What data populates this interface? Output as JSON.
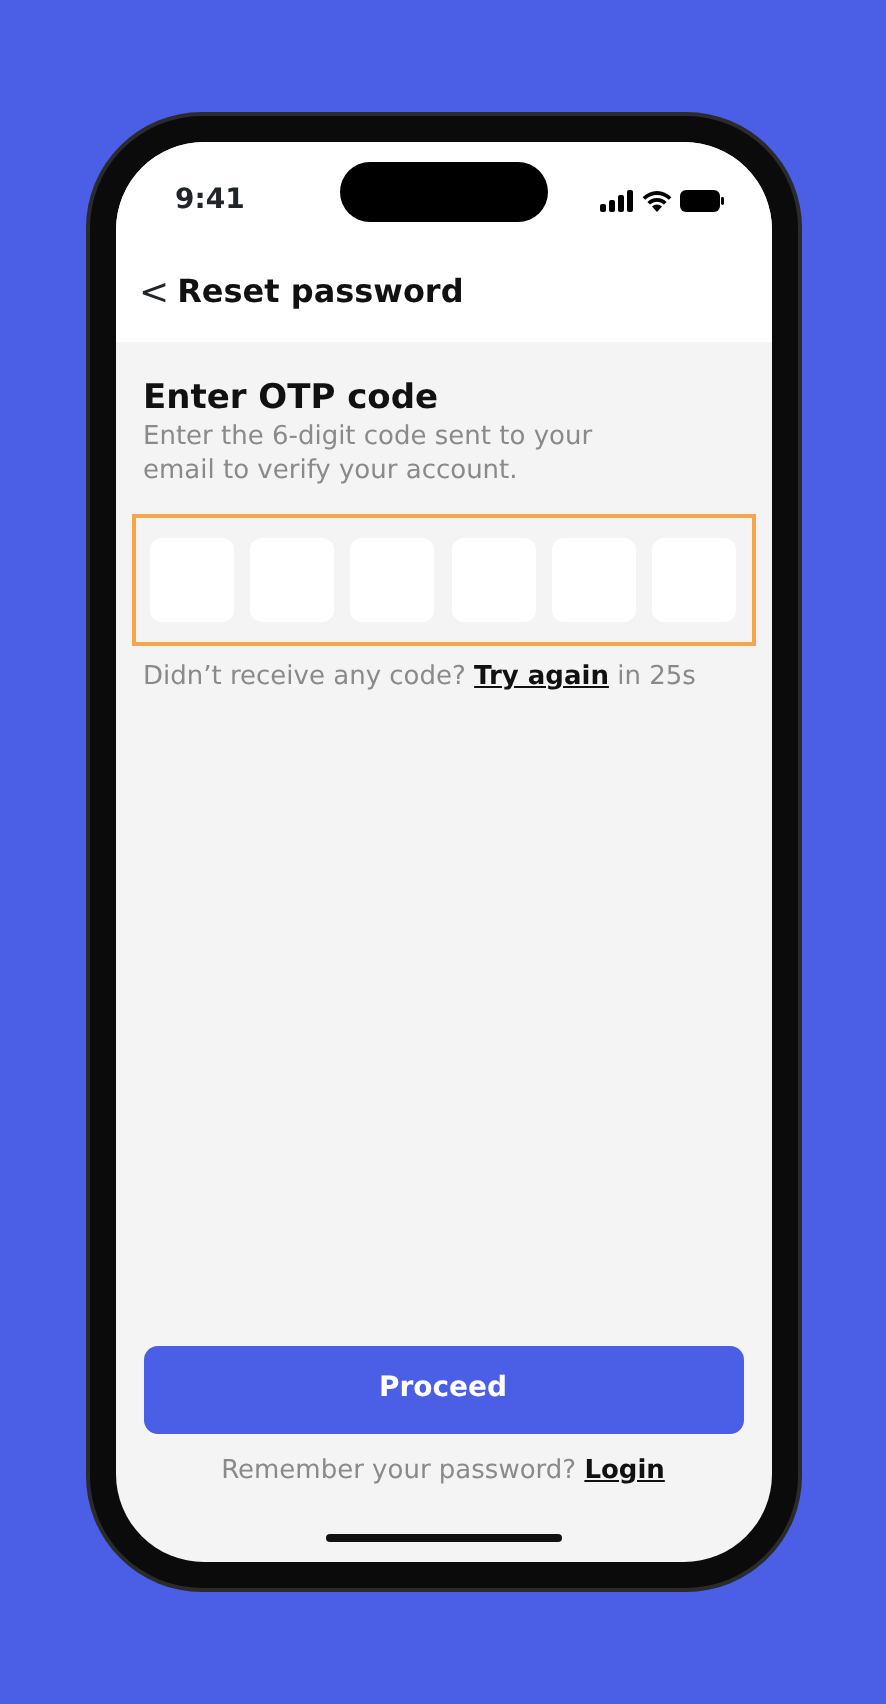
{
  "status_bar": {
    "time": "9:41"
  },
  "header": {
    "back_icon": "<",
    "title": "Reset password"
  },
  "heading": "Enter OTP code",
  "subtitle": "Enter the 6-digit code sent to your email to verify your account.",
  "otp": {
    "highlighted": true,
    "fields": [
      {
        "kind": "digit"
      },
      {
        "kind": "digit"
      },
      {
        "kind": "digit"
      },
      {
        "kind": "digit"
      },
      {
        "kind": "digit"
      },
      {
        "kind": "digit"
      }
    ]
  },
  "resend": {
    "prompt": "Didn’t receive any code?",
    "link": "Try again",
    "countdown": "in 25s"
  },
  "primary_button": "Proceed",
  "footer": {
    "prompt": "Remember your password?",
    "link": "Login"
  }
}
